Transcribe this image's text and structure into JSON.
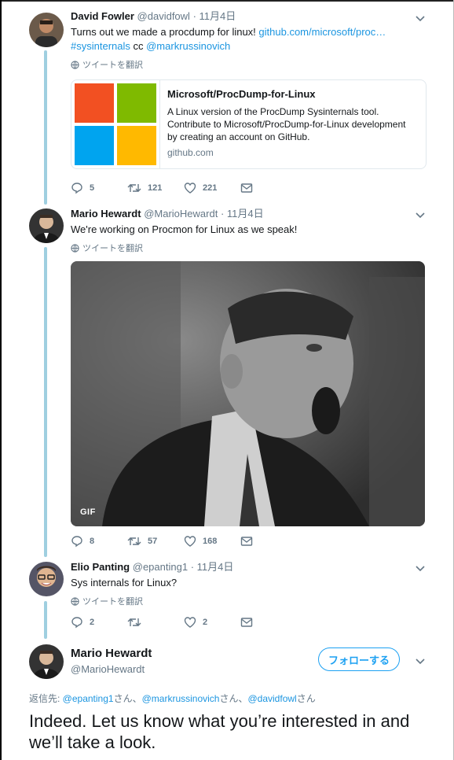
{
  "tweets": [
    {
      "name": "David Fowler",
      "handle": "@davidfowl",
      "date": "· 11月4日",
      "text_before": "Turns out we made a procdump for linux! ",
      "link": "github.com/microsoft/proc…",
      "hashtag": "#sysinternals",
      "cc": " cc ",
      "mention": "@markrussinovich",
      "translate": "ツイートを翻訳",
      "card": {
        "title": "Microsoft/ProcDump-for-Linux",
        "description": "A Linux version of the ProcDump Sysinternals tool. Contribute to Microsoft/ProcDump-for-Linux development by creating an account on GitHub.",
        "domain": "github.com"
      },
      "replies": "5",
      "retweets": "121",
      "likes": "221"
    },
    {
      "name": "Mario Hewardt",
      "handle": "@MarioHewardt",
      "date": "· 11月4日",
      "text": "We're working on Procmon for Linux as we speak!",
      "translate": "ツイートを翻訳",
      "gif_label": "GIF",
      "replies": "8",
      "retweets": "57",
      "likes": "168"
    },
    {
      "name": "Elio Panting",
      "handle": "@epanting1",
      "date": "· 11月4日",
      "text": "Sys internals for Linux?",
      "translate": "ツイートを翻訳",
      "replies": "2",
      "retweets": "",
      "likes": "2"
    }
  ],
  "main": {
    "name": "Mario Hewardt",
    "handle": "@MarioHewardt",
    "follow_label": "フォローする",
    "reply_prefix": "返信先: ",
    "reply_1": "@epanting1",
    "reply_sep1": "さん、",
    "reply_2": "@markrussinovich",
    "reply_sep2": "さん、",
    "reply_3": "@davidfowl",
    "reply_suffix": "さん",
    "text": "Indeed. Let us know what you’re interested in and we’ll take a look."
  },
  "colors": {
    "link": "#1b95e0",
    "accent": "#1da1f2",
    "thread": "#9fcfe0",
    "muted": "#657786"
  },
  "icons": [
    "reply-icon",
    "retweet-icon",
    "like-icon",
    "dm-icon",
    "chevron-down-icon",
    "globe-icon"
  ]
}
